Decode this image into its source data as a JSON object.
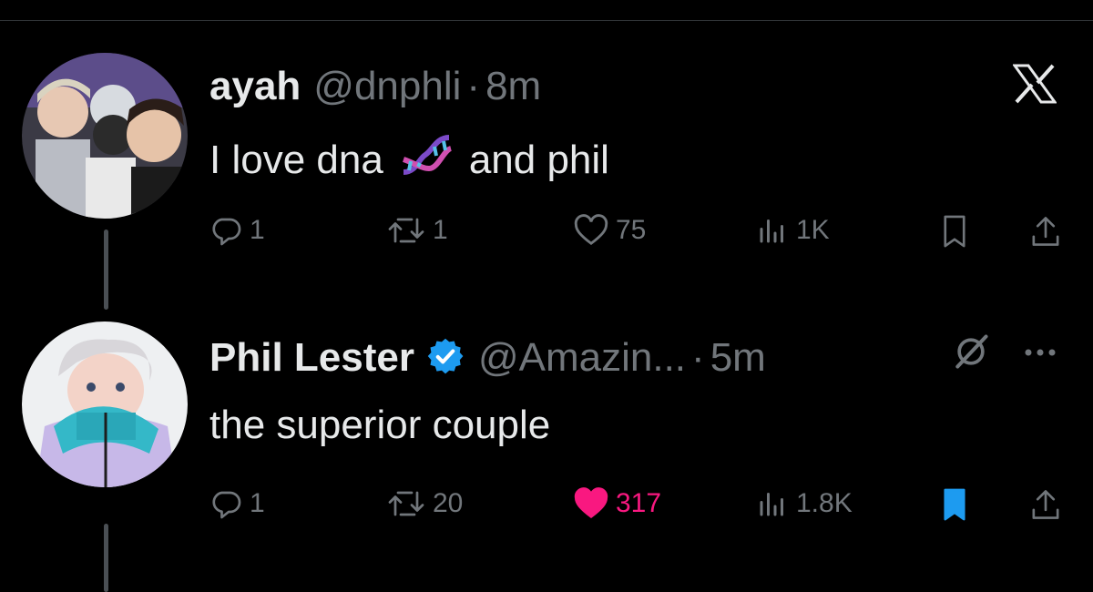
{
  "tweets": [
    {
      "name": "ayah",
      "handle": "@dnphli",
      "time": "8m",
      "text_before": "I love dna",
      "emoji": "dna",
      "text_after": "and phil",
      "replies": "1",
      "retweets": "1",
      "likes": "75",
      "views": "1K",
      "liked": false,
      "bookmarked": false
    },
    {
      "name": "Phil Lester",
      "handle": "@Amazin...",
      "time": "5m",
      "text": "the superior couple",
      "replies": "1",
      "retweets": "20",
      "likes": "317",
      "views": "1.8K",
      "liked": true,
      "bookmarked": true,
      "verified": true
    }
  ],
  "colors": {
    "background": "#000000",
    "text": "#e7e9ea",
    "muted": "#71767b",
    "like": "#f91880",
    "bookmark": "#1d9bf0",
    "verified": "#1d9bf0"
  },
  "icons": [
    "x-logo-icon",
    "reply-icon",
    "retweet-icon",
    "heart-icon",
    "views-icon",
    "bookmark-icon",
    "share-icon",
    "verified-badge-icon",
    "grok-icon",
    "more-icon",
    "dna-emoji"
  ]
}
